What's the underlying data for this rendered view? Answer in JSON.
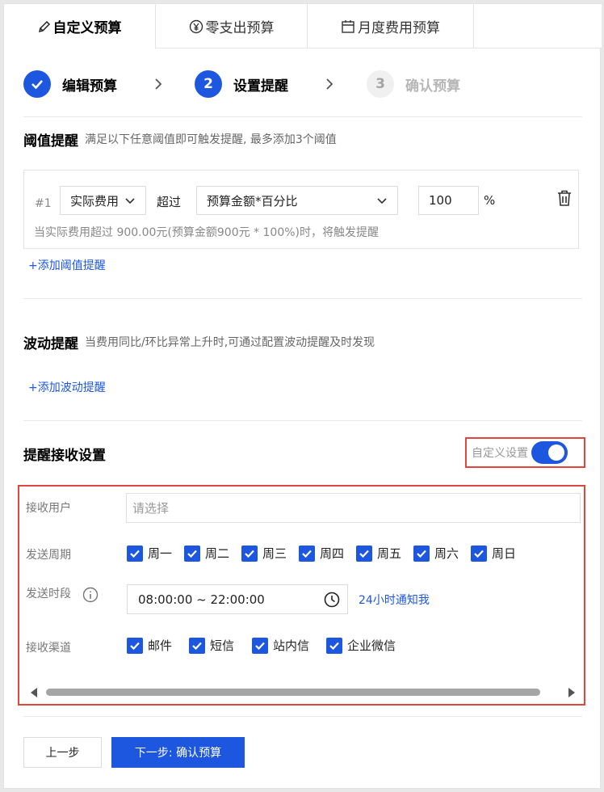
{
  "tabs": [
    {
      "label": "自定义预算",
      "icon": "pencil-icon"
    },
    {
      "label": "零支出预算",
      "icon": "yen-circle-icon"
    },
    {
      "label": "月度费用预算",
      "icon": "calendar-icon"
    }
  ],
  "steps": [
    {
      "number": "",
      "label": "编辑预算",
      "state": "done"
    },
    {
      "number": "2",
      "label": "设置提醒",
      "state": "current"
    },
    {
      "number": "3",
      "label": "确认预算",
      "state": "todo"
    }
  ],
  "threshold": {
    "title": "阈值提醒",
    "desc": "满足以下任意阈值即可触发提醒, 最多添加3个阈值",
    "rule": {
      "index": "#1",
      "metric": "实际费用",
      "operator": "超过",
      "base": "预算金额*百分比",
      "value": "100",
      "unit": "%",
      "hint": "当实际费用超过 900.00元(预算金额900元 * 100%)时，将触发提醒"
    },
    "add_link": "+添加阈值提醒"
  },
  "fluctuation": {
    "title": "波动提醒",
    "desc": "当费用同比/环比异常上升时,可通过配置波动提醒及时发现",
    "add_link": "+添加波动提醒"
  },
  "receive": {
    "title": "提醒接收设置",
    "toggle_label": "自定义设置",
    "toggle_on": true,
    "users_label": "接收用户",
    "users_placeholder": "请选择",
    "period_label": "发送周期",
    "days": [
      "周一",
      "周二",
      "周三",
      "周四",
      "周五",
      "周六",
      "周日"
    ],
    "time_label": "发送时段",
    "time_value": "08:00:00 ~ 22:00:00",
    "time_link": "24小时通知我",
    "channel_label": "接收渠道",
    "channels": [
      "邮件",
      "短信",
      "站内信",
      "企业微信"
    ]
  },
  "footer": {
    "prev": "上一步",
    "next": "下一步: 确认预算"
  },
  "colors": {
    "primary": "#1d57e0",
    "highlight_border": "#e0463c"
  }
}
